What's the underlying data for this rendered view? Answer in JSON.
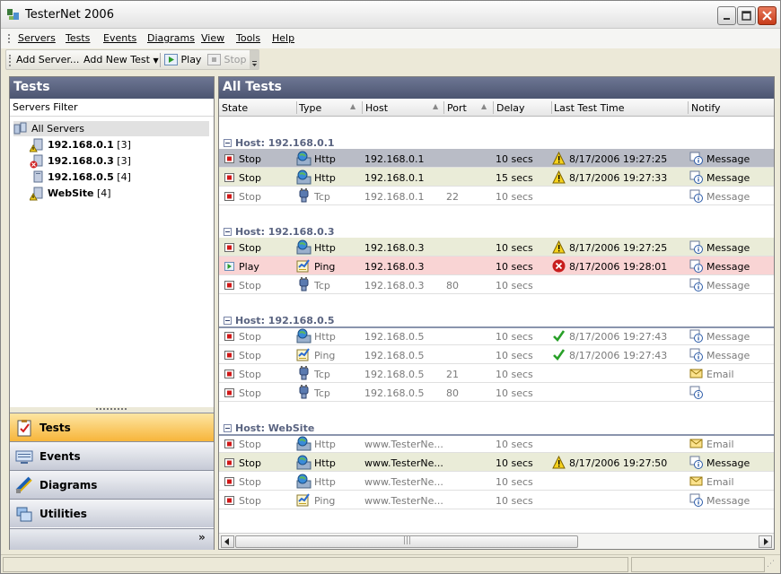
{
  "window": {
    "title": "TesterNet 2006"
  },
  "menu": [
    "Servers",
    "Tests",
    "Events",
    "Diagrams",
    "View",
    "Tools",
    "Help"
  ],
  "toolbar": {
    "add_server": "Add Server...",
    "add_new_test": "Add New Test",
    "play": "Play",
    "stop": "Stop"
  },
  "left_panel": {
    "title": "Tests",
    "filter_label": "Servers Filter",
    "tree": {
      "root": "All Servers",
      "servers": [
        {
          "name": "192.168.0.1",
          "count": "[3]",
          "status_icon": "warning-icon"
        },
        {
          "name": "192.168.0.3",
          "count": "[3]",
          "status_icon": "error-icon"
        },
        {
          "name": "192.168.0.5",
          "count": "[4]",
          "status_icon": "none"
        },
        {
          "name": "WebSite",
          "count": "[4]",
          "status_icon": "warning-icon"
        }
      ]
    },
    "nav": [
      {
        "label": "Tests",
        "icon": "clipboard-icon",
        "active": true
      },
      {
        "label": "Events",
        "icon": "monitor-icon",
        "active": false
      },
      {
        "label": "Diagrams",
        "icon": "diagram-icon",
        "active": false
      },
      {
        "label": "Utilities",
        "icon": "folders-icon",
        "active": false
      }
    ]
  },
  "right_panel": {
    "title": "All Tests",
    "columns": [
      "State",
      "Type",
      "Host",
      "Port",
      "Delay",
      "Last Test Time",
      "Notify"
    ],
    "groups": [
      {
        "label": "Host: 192.168.0.1",
        "rows": [
          {
            "state": "Stop",
            "type": "Http",
            "host": "192.168.0.1",
            "port": "",
            "delay": "10 secs",
            "status_icon": "warning",
            "time": "8/17/2006 19:27:25",
            "notify": "Message",
            "style": "selected"
          },
          {
            "state": "Stop",
            "type": "Http",
            "host": "192.168.0.1",
            "port": "",
            "delay": "15 secs",
            "status_icon": "warning",
            "time": "8/17/2006 19:27:33",
            "notify": "Message",
            "style": "warn"
          },
          {
            "state": "Stop",
            "type": "Tcp",
            "host": "192.168.0.1",
            "port": "22",
            "delay": "10 secs",
            "status_icon": "",
            "time": "",
            "notify": "Message",
            "style": "dim"
          }
        ]
      },
      {
        "label": "Host: 192.168.0.3",
        "rows": [
          {
            "state": "Stop",
            "type": "Http",
            "host": "192.168.0.3",
            "port": "",
            "delay": "10 secs",
            "status_icon": "warning",
            "time": "8/17/2006 19:27:25",
            "notify": "Message",
            "style": "warn"
          },
          {
            "state": "Play",
            "type": "Ping",
            "host": "192.168.0.3",
            "port": "",
            "delay": "10 secs",
            "status_icon": "error",
            "time": "8/17/2006 19:28:01",
            "notify": "Message",
            "style": "err"
          },
          {
            "state": "Stop",
            "type": "Tcp",
            "host": "192.168.0.3",
            "port": "80",
            "delay": "10 secs",
            "status_icon": "",
            "time": "",
            "notify": "Message",
            "style": "dim"
          }
        ]
      },
      {
        "label": "Host: 192.168.0.5",
        "rows": [
          {
            "state": "Stop",
            "type": "Http",
            "host": "192.168.0.5",
            "port": "",
            "delay": "10 secs",
            "status_icon": "ok",
            "time": "8/17/2006 19:27:43",
            "notify": "Message",
            "style": "dim"
          },
          {
            "state": "Stop",
            "type": "Ping",
            "host": "192.168.0.5",
            "port": "",
            "delay": "10 secs",
            "status_icon": "ok",
            "time": "8/17/2006 19:27:43",
            "notify": "Message",
            "style": "dim"
          },
          {
            "state": "Stop",
            "type": "Tcp",
            "host": "192.168.0.5",
            "port": "21",
            "delay": "10 secs",
            "status_icon": "",
            "time": "",
            "notify": "Email",
            "style": "dim"
          },
          {
            "state": "Stop",
            "type": "Tcp",
            "host": "192.168.0.5",
            "port": "80",
            "delay": "10 secs",
            "status_icon": "",
            "time": "",
            "notify": "",
            "style": "dim"
          }
        ]
      },
      {
        "label": "Host: WebSite",
        "rows": [
          {
            "state": "Stop",
            "type": "Http",
            "host": "www.TesterNe...",
            "port": "",
            "delay": "10 secs",
            "status_icon": "",
            "time": "",
            "notify": "Email",
            "style": "dim"
          },
          {
            "state": "Stop",
            "type": "Http",
            "host": "www.TesterNe...",
            "port": "",
            "delay": "10 secs",
            "status_icon": "warning",
            "time": "8/17/2006 19:27:50",
            "notify": "Message",
            "style": "warn"
          },
          {
            "state": "Stop",
            "type": "Http",
            "host": "www.TesterNe...",
            "port": "",
            "delay": "10 secs",
            "status_icon": "",
            "time": "",
            "notify": "Email",
            "style": "dim"
          },
          {
            "state": "Stop",
            "type": "Ping",
            "host": "www.TesterNe...",
            "port": "",
            "delay": "10 secs",
            "status_icon": "",
            "time": "",
            "notify": "Message",
            "style": "dim"
          }
        ]
      }
    ]
  },
  "colors": {
    "panel_header": "#5b6482",
    "group_text": "#596380",
    "active_nav": "#f7b53a",
    "warn_row": "#eaecd8",
    "error_row": "#f9d4d4",
    "selected_row": "#b9bcc6"
  }
}
